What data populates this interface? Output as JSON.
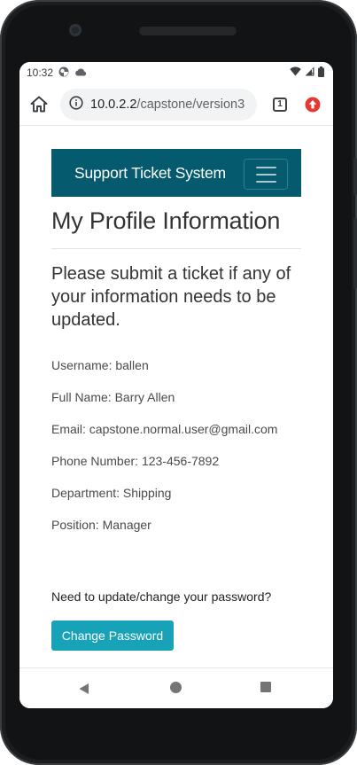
{
  "status_bar": {
    "time": "10:32",
    "icons": [
      "notification-badge-icon",
      "cloud-icon",
      "wifi-icon",
      "signal-icon",
      "battery-icon"
    ]
  },
  "browser": {
    "url_host": "10.0.2.2",
    "url_path": "/capstone/version3",
    "tab_count": "1"
  },
  "navbar": {
    "brand": "Support Ticket System",
    "bg_color": "#055a6e"
  },
  "profile": {
    "title": "My Profile Information",
    "notice": "Please submit a ticket if any of your information needs to be updated.",
    "fields": [
      "Username: ballen",
      "Full Name: Barry Allen",
      "Email: capstone.normal.user@gmail.com",
      "Phone Number: 123-456-7892",
      "Department: Shipping",
      "Position: Manager"
    ]
  },
  "password": {
    "question": "Need to update/change your password?",
    "button_label": "Change Password",
    "button_color": "#17a2b8"
  }
}
